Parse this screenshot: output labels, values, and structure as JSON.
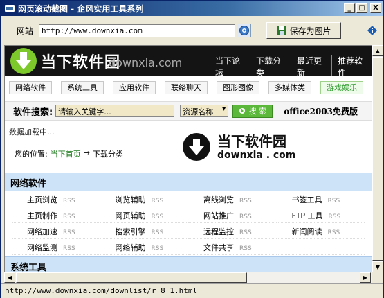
{
  "window": {
    "title": "网页滚动截图 - 企风实用工具系列",
    "buttons": {
      "minimize": "_",
      "maximize": "□",
      "close": "X"
    }
  },
  "toolbar": {
    "url_label": "网站",
    "url_value": "http://www.downxia.com",
    "save_label": "保存为图片"
  },
  "site": {
    "logo_text": "当下软件园",
    "logo_domain": "downxia.com",
    "nav": [
      "当下论坛",
      "下载分类",
      "最近更新",
      "推荐软件"
    ],
    "categories": [
      "网络软件",
      "系统工具",
      "应用软件",
      "联络聊天",
      "图形图像",
      "多媒体类",
      "游戏娱乐"
    ],
    "search": {
      "label": "软件搜索:",
      "placeholder": "请输入关键字...",
      "select_value": "资源名称",
      "button": "搜 索"
    },
    "promo": "office2003免费版",
    "loading": "数据加载中...",
    "breadcrumb": {
      "prefix": "您的位置:",
      "home": "当下首页",
      "arrow": "→",
      "current": "下载分类"
    },
    "watermark": {
      "text": "当下软件园",
      "domain": "downxia . com"
    },
    "sections": [
      {
        "title": "网络软件",
        "rows": [
          [
            "主页浏览",
            "浏览辅助",
            "离线浏览",
            "书签工具"
          ],
          [
            "主页制作",
            "网页辅助",
            "网站推广",
            "FTP 工具"
          ],
          [
            "网络加速",
            "搜索引擎",
            "远程监控",
            "新闻阅读"
          ],
          [
            "网络监测",
            "网络辅助",
            "文件共享",
            ""
          ]
        ]
      },
      {
        "title": "系统工具",
        "rows": []
      }
    ],
    "rss": "RSS"
  },
  "status": {
    "text": "http://www.downxia.com/downlist/r_8_1.html"
  },
  "colors": {
    "title_bar": "#0a246a",
    "accent_green": "#5bb83a",
    "section_bg": "#cde3f7"
  }
}
